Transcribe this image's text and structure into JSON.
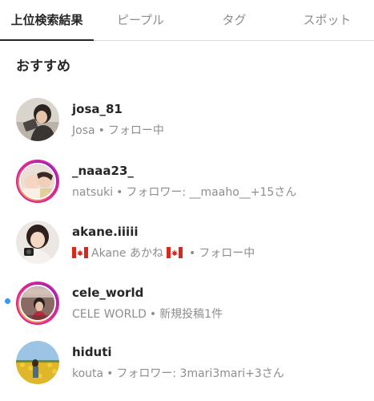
{
  "tabs": {
    "top": "上位検索結果",
    "people": "ピープル",
    "tags": "タグ",
    "places": "スポット"
  },
  "section": {
    "heading": "おすすめ"
  },
  "results": [
    {
      "username": "josa_81",
      "name": "Josa",
      "status": "フォロー中"
    },
    {
      "username": "_naaa23_",
      "name": "natsuki",
      "status": "フォロワー: __maaho__+15さん"
    },
    {
      "username": "akane.iiiii",
      "name": "Akane あかね",
      "status": "フォロー中",
      "flag_icon": "canada-flag-icon"
    },
    {
      "username": "cele_world",
      "name": "CELE WORLD",
      "status": "新規投稿1件"
    },
    {
      "username": "hiduti",
      "name": "kouta",
      "status": "フォロワー: 3mari3mari+3さん"
    }
  ],
  "separator": "•",
  "colors": {
    "text_primary": "#262626",
    "text_secondary": "#8e8e8e",
    "unseen_dot": "#3897f0",
    "story_ring": "#d6249f",
    "divider": "#dbdbdb"
  }
}
